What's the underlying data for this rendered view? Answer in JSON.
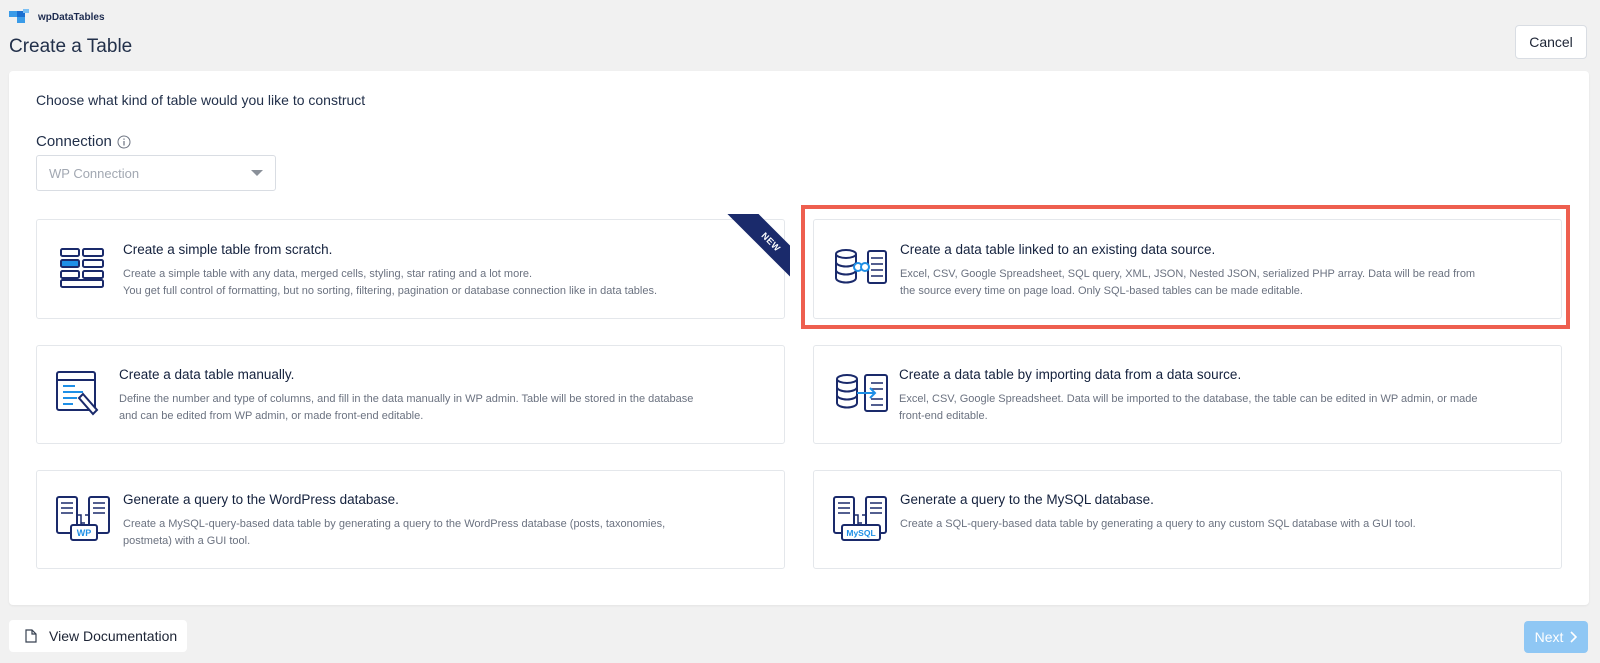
{
  "app": {
    "brand_name": "wpDataTables",
    "page_title": "Create a Table"
  },
  "header": {
    "cancel_label": "Cancel"
  },
  "main": {
    "prompt": "Choose what kind of table would you like to construct",
    "connection": {
      "label": "Connection",
      "selected": "WP Connection",
      "info_icon": "info-circle-icon"
    },
    "ribbon_text": "NEW",
    "cards": [
      {
        "title": "Create a simple table from scratch.",
        "desc_line1": "Create a simple table with any data, merged cells, styling, star rating and a lot more.",
        "desc_line2": "You get full control of formatting, but no sorting, filtering, pagination or database connection like in data tables.",
        "icon": "simple-table-icon"
      },
      {
        "title": "Create a data table linked to an existing data source.",
        "desc_line1": "Excel, CSV, Google Spreadsheet, SQL query, XML, JSON, Nested JSON, serialized PHP array. Data will be read from",
        "desc_line2": "the source every time on page load. Only SQL-based tables can be made editable.",
        "icon": "linked-data-source-icon"
      },
      {
        "title": "Create a data table manually.",
        "desc_line1": "Define the number and type of columns, and fill in the data manually in WP admin. Table will be stored in the database",
        "desc_line2": "and can be edited from WP admin, or made front-end editable.",
        "icon": "manual-table-icon"
      },
      {
        "title": "Create a data table by importing data from a data source.",
        "desc_line1": "Excel, CSV, Google Spreadsheet. Data will be imported to the database, the table can be edited in WP admin, or made",
        "desc_line2": "front-end editable.",
        "icon": "import-data-icon"
      },
      {
        "title": "Generate a query to the WordPress database.",
        "desc_line1": "Create a MySQL-query-based data table by generating a query to the WordPress database (posts, taxonomies,",
        "desc_line2": "postmeta) with a GUI tool.",
        "icon": "wp-query-icon",
        "badge": "WP"
      },
      {
        "title": "Generate a query to the MySQL database.",
        "desc_line1": "Create a SQL-query-based data table by generating a query to any custom SQL database with a GUI tool.",
        "desc_line2": "",
        "icon": "mysql-query-icon",
        "badge": "MySQL"
      }
    ]
  },
  "footer": {
    "docs_label": "View Documentation",
    "next_label": "Next"
  },
  "colors": {
    "accent": "#1a2a6b",
    "highlight": "#ee5f4f",
    "next_disabled": "#8fc7f4",
    "icon_blue": "#1e8fe6"
  }
}
